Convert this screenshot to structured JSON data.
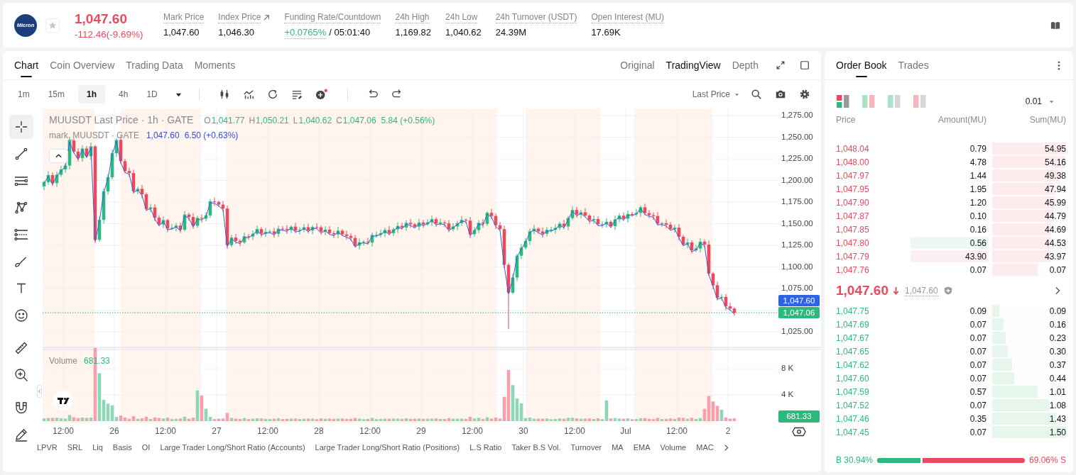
{
  "ticker": {
    "logo": "Micron",
    "favorite": false,
    "price": "1,047.60",
    "change": "-112.46(-9.69%)",
    "falling": true
  },
  "stats": [
    {
      "kind": "plain",
      "label": "Mark Price",
      "value": "1,047.60"
    },
    {
      "kind": "link",
      "label": "Index Price",
      "value": "1,046.30"
    },
    {
      "kind": "funding",
      "label": "Funding Rate/Countdown",
      "value": "+0.0765%",
      "countdown": "/ 05:01:40"
    },
    {
      "kind": "plain",
      "label": "24h High",
      "value": "1,169.82"
    },
    {
      "kind": "plain",
      "label": "24h Low",
      "value": "1,040.62"
    },
    {
      "kind": "plain",
      "label": "24h Turnover (USDT)",
      "value": "24.39M"
    },
    {
      "kind": "plain",
      "label": "Open Interest (MU)",
      "value": "17.69K"
    }
  ],
  "chart_tabs": [
    {
      "label": "Chart",
      "selected": true
    },
    {
      "label": "Coin Overview",
      "selected": false
    },
    {
      "label": "Trading Data",
      "selected": false
    },
    {
      "label": "Moments",
      "selected": false
    }
  ],
  "view_modes": [
    {
      "label": "Original",
      "selected": false
    },
    {
      "label": "TradingView",
      "selected": true
    },
    {
      "label": "Depth",
      "selected": false
    }
  ],
  "intervals": [
    {
      "label": "1m",
      "selected": false
    },
    {
      "label": "15m",
      "selected": false
    },
    {
      "label": "1h",
      "selected": true
    },
    {
      "label": "4h",
      "selected": false
    },
    {
      "label": "1D",
      "selected": false
    }
  ],
  "price_source": "Last Price",
  "drawing_tool_groups": [
    {
      "tools": [
        {
          "kind": "crosshair",
          "selected": true
        },
        {
          "kind": "line",
          "selected": false
        },
        {
          "kind": "hlines",
          "selected": false
        },
        {
          "kind": "pattern",
          "selected": false
        },
        {
          "kind": "fib",
          "selected": false
        },
        {
          "kind": "brush",
          "selected": false
        },
        {
          "kind": "text",
          "selected": false
        },
        {
          "kind": "emoji",
          "selected": false
        }
      ]
    },
    {
      "tools": [
        {
          "kind": "ruler",
          "selected": false
        },
        {
          "kind": "zoom",
          "selected": false
        }
      ]
    },
    {
      "tools": [
        {
          "kind": "magnet",
          "selected": false
        },
        {
          "kind": "pencil",
          "selected": false
        }
      ]
    }
  ],
  "legend": {
    "title": "MUUSDT Last Price · 1h · GATE",
    "ohlc": [
      {
        "key": "O",
        "value": "1,041.77"
      },
      {
        "key": "H",
        "value": "1,050.21"
      },
      {
        "key": "L",
        "value": "1,040.62"
      },
      {
        "key": "C",
        "value": "1,047.06"
      }
    ],
    "change": "5.84 (+0.56%)"
  },
  "mark_legend": {
    "title": "mark_MUUSDT · GATE",
    "value": "1,047.60",
    "change": "6.50 (+0.63%)"
  },
  "price_axis": [
    "1,275.00",
    "1,250.00",
    "1,225.00",
    "1,200.00",
    "1,175.00",
    "1,150.00",
    "1,125.00",
    "1,100.00",
    "1,075.00",
    "1,025.00"
  ],
  "price_badges": [
    {
      "value": "1,047.60",
      "color": "#2e63e8"
    },
    {
      "value": "1,047.06",
      "color": "#2cb97d"
    }
  ],
  "volume": {
    "label": "Volume",
    "value": "681.33",
    "axis": [
      "8 K",
      "4 K"
    ],
    "badge": "681.33"
  },
  "time_axis": [
    "12:00",
    "26",
    "12:00",
    "27",
    "12:00",
    "28",
    "12:00",
    "29",
    "12:00",
    "30",
    "12:00",
    "Jul",
    "12:00",
    "2"
  ],
  "indicators": [
    "LPVR",
    "SRL",
    "Liq",
    "Basis",
    "OI",
    "Large Trader Long/Short Ratio (Accounts)",
    "Large Trader Long/Short Ratio (Positions)",
    "L.S Ratio",
    "Taker B.S Vol.",
    "Turnover",
    "MA",
    "EMA",
    "Volume",
    "MAC"
  ],
  "order_book": {
    "tabs": [
      {
        "label": "Order Book",
        "selected": true
      },
      {
        "label": "Trades",
        "selected": false
      }
    ],
    "views": [
      {
        "kind": "split",
        "selected": true
      },
      {
        "kind": "mixed",
        "selected": false
      },
      {
        "kind": "bids",
        "selected": false
      },
      {
        "kind": "asks",
        "selected": false
      }
    ],
    "precision": "0.01",
    "columns": [
      "Price",
      "Amount(MU)",
      "Sum(MU)"
    ],
    "asks": [
      {
        "kind": "plain",
        "price": "1,048.04",
        "amount": "0.79",
        "sum": "54.95",
        "level": 1
      },
      {
        "kind": "plain",
        "price": "1,048.00",
        "amount": "4.78",
        "sum": "54.16",
        "level": 0.99
      },
      {
        "kind": "plain",
        "price": "1,047.97",
        "amount": "1.44",
        "sum": "49.38",
        "level": 0.9
      },
      {
        "kind": "plain",
        "price": "1,047.95",
        "amount": "1.95",
        "sum": "47.94",
        "level": 0.85
      },
      {
        "kind": "plain",
        "price": "1,047.90",
        "amount": "1.20",
        "sum": "45.99",
        "level": 0.85
      },
      {
        "kind": "plain",
        "price": "1,047.87",
        "amount": "0.10",
        "sum": "44.79",
        "level": 0.84
      },
      {
        "kind": "plain",
        "price": "1,047.85",
        "amount": "0.16",
        "sum": "44.69",
        "level": 0.8
      },
      {
        "kind": "buyflash",
        "price": "1,047.80",
        "amount": "0.56",
        "sum": "44.53",
        "level": 0.8
      },
      {
        "kind": "sellflash",
        "price": "1,047.79",
        "amount": "43.90",
        "sum": "43.97",
        "level": 0.8
      },
      {
        "kind": "plain",
        "price": "1,047.76",
        "amount": "0.07",
        "sum": "0.07",
        "level": 0.62
      }
    ],
    "last": {
      "price": "1,047.60",
      "falling": true,
      "mark": "1,047.60"
    },
    "bids": [
      {
        "price": "1,047.75",
        "amount": "0.09",
        "sum": "0.09",
        "level": 0.1
      },
      {
        "price": "1,047.69",
        "amount": "0.07",
        "sum": "0.16",
        "level": 0.15
      },
      {
        "price": "1,047.67",
        "amount": "0.07",
        "sum": "0.23",
        "level": 0.18
      },
      {
        "price": "1,047.65",
        "amount": "0.07",
        "sum": "0.30",
        "level": 0.21
      },
      {
        "price": "1,047.62",
        "amount": "0.07",
        "sum": "0.37",
        "level": 0.27
      },
      {
        "price": "1,047.60",
        "amount": "0.07",
        "sum": "0.44",
        "level": 0.3
      },
      {
        "price": "1,047.59",
        "amount": "0.57",
        "sum": "1.01",
        "level": 0.62
      },
      {
        "price": "1,047.52",
        "amount": "0.07",
        "sum": "1.08",
        "level": 0.77
      },
      {
        "price": "1,047.46",
        "amount": "0.35",
        "sum": "1.43",
        "level": 0.87
      },
      {
        "price": "1,047.45",
        "amount": "0.07",
        "sum": "1.50",
        "level": 1
      }
    ],
    "ratio": {
      "buy": "B 30.94%",
      "sell": "69.06% S",
      "level": 0.3094
    }
  }
}
